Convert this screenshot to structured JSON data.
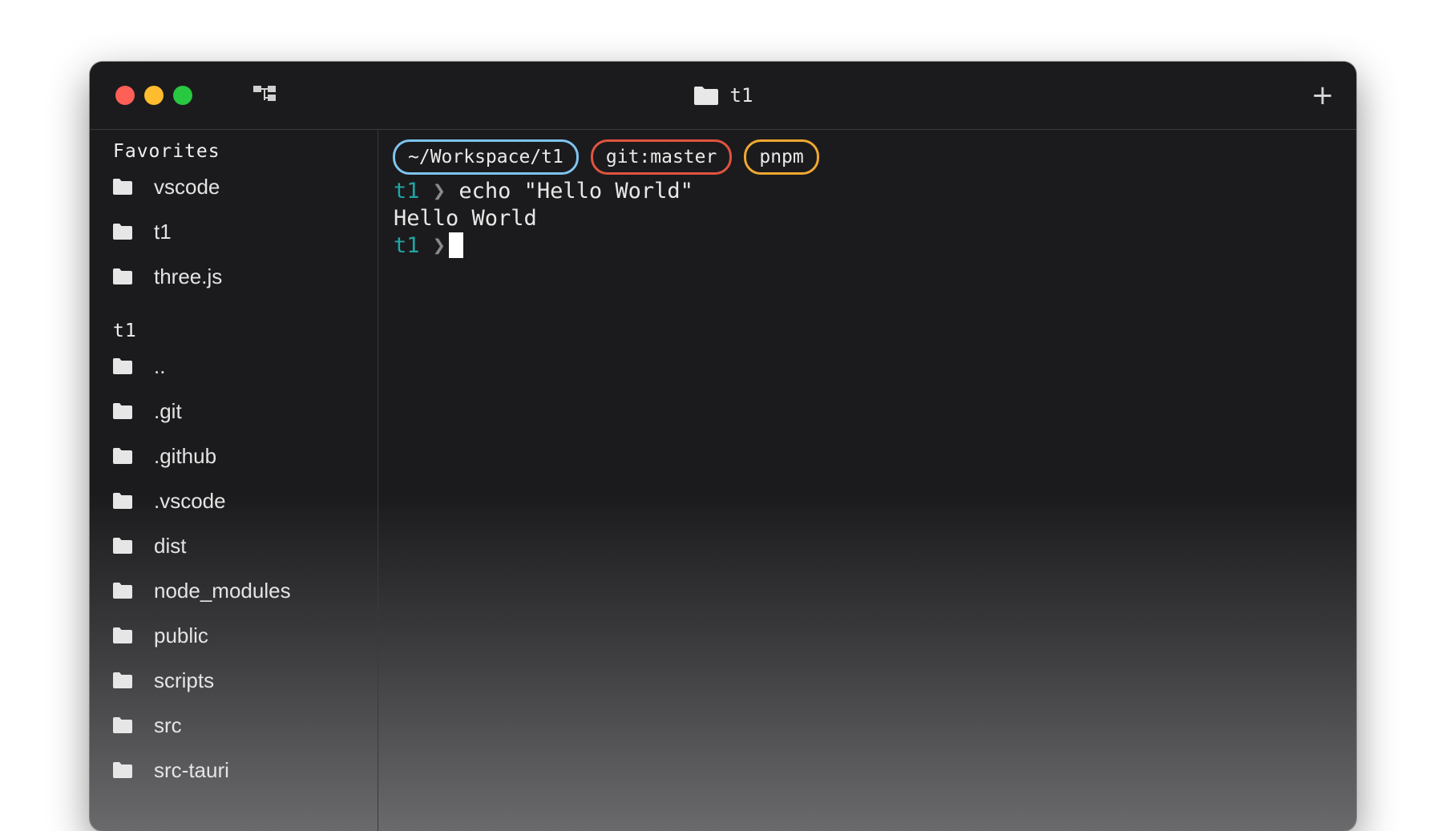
{
  "window": {
    "title": "t1",
    "new_tab_label": "+"
  },
  "colors": {
    "close": "#fe5f57",
    "minimize": "#febc2e",
    "zoom": "#28c840",
    "path_badge": "#7ec3f0",
    "git_badge": "#e0533f",
    "pm_badge": "#f0a830",
    "prompt_dir": "#1fa7a5"
  },
  "sidebar": {
    "favorites_header": "Favorites",
    "favorites": [
      {
        "label": "vscode",
        "icon": "folder-icon"
      },
      {
        "label": "t1",
        "icon": "folder-icon"
      },
      {
        "label": "three.js",
        "icon": "folder-icon"
      }
    ],
    "current_header": "t1",
    "entries": [
      {
        "label": "..",
        "icon": "folder-icon"
      },
      {
        "label": ".git",
        "icon": "folder-icon"
      },
      {
        "label": ".github",
        "icon": "folder-icon"
      },
      {
        "label": ".vscode",
        "icon": "folder-icon"
      },
      {
        "label": "dist",
        "icon": "folder-icon"
      },
      {
        "label": "node_modules",
        "icon": "folder-icon"
      },
      {
        "label": "public",
        "icon": "folder-icon"
      },
      {
        "label": "scripts",
        "icon": "folder-icon"
      },
      {
        "label": "src",
        "icon": "folder-icon"
      },
      {
        "label": "src-tauri",
        "icon": "folder-icon"
      }
    ]
  },
  "terminal": {
    "badges": {
      "path": "~/Workspace/t1",
      "git": "git:master",
      "package_manager": "pnpm"
    },
    "lines": [
      {
        "prompt_dir": "t1",
        "prompt_arrow": "❯",
        "command": "echo \"Hello World\""
      },
      {
        "output": "Hello World"
      },
      {
        "prompt_dir": "t1",
        "prompt_arrow": "❯",
        "command": ""
      }
    ]
  }
}
